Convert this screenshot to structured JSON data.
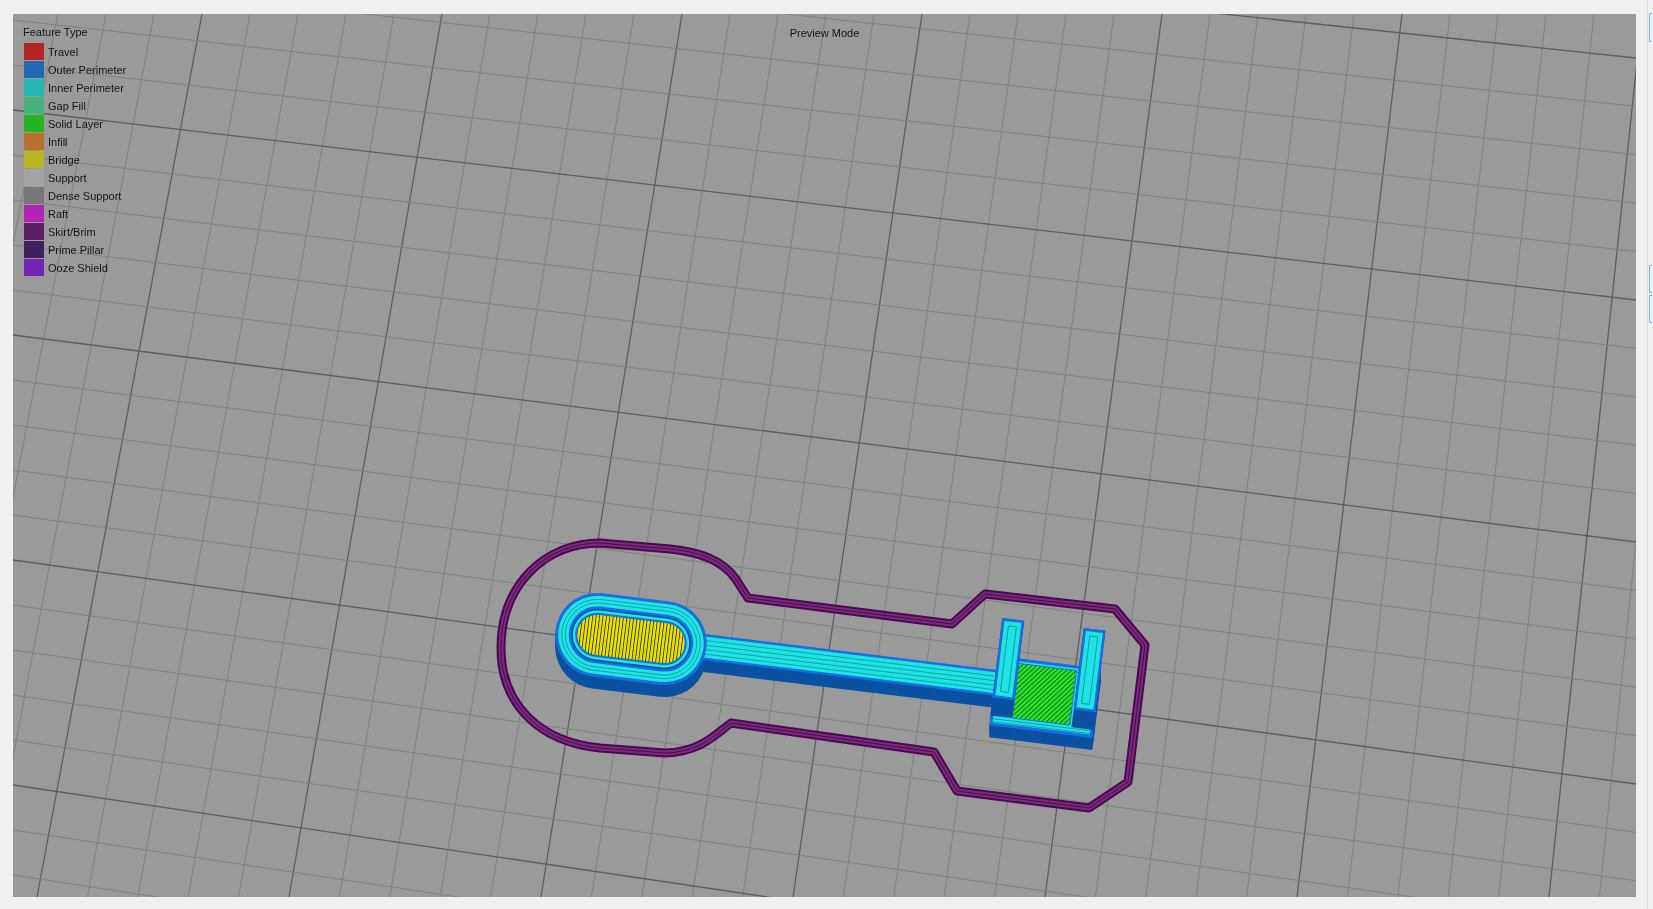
{
  "viewport": {
    "mode_label": "Preview Mode"
  },
  "legend": {
    "title": "Feature Type",
    "items": [
      {
        "label": "Travel",
        "color": "#b42424"
      },
      {
        "label": "Outer Perimeter",
        "color": "#2468b4"
      },
      {
        "label": "Inner Perimeter",
        "color": "#26b6b6"
      },
      {
        "label": "Gap Fill",
        "color": "#46b27c"
      },
      {
        "label": "Solid Layer",
        "color": "#24b424"
      },
      {
        "label": "Infill",
        "color": "#b8702c"
      },
      {
        "label": "Bridge",
        "color": "#b8b424"
      },
      {
        "label": "Support",
        "color": "#a4a4a4"
      },
      {
        "label": "Dense Support",
        "color": "#787878"
      },
      {
        "label": "Raft",
        "color": "#b424b4"
      },
      {
        "label": "Skirt/Brim",
        "color": "#5c2060"
      },
      {
        "label": "Prime Pillar",
        "color": "#3c2060"
      },
      {
        "label": "Ooze Shield",
        "color": "#7424b4"
      }
    ]
  }
}
